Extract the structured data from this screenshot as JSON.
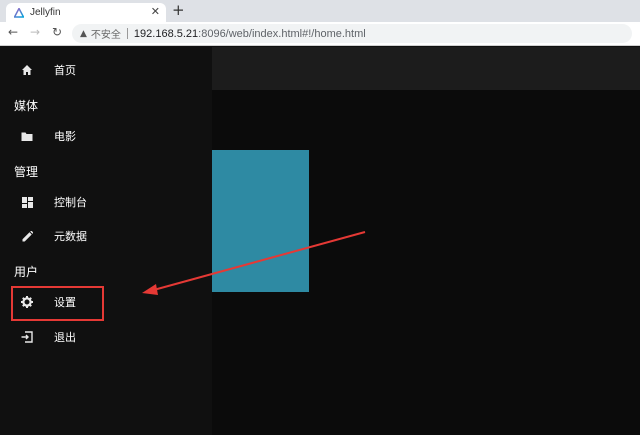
{
  "browser": {
    "tab_title": "Jellyfin",
    "tab_close": "✕",
    "new_tab": "+",
    "back": "←",
    "forward": "→",
    "reload": "↻",
    "insecure_label": "不安全",
    "url_host": "192.168.5.21",
    "url_path": ":8096/web/index.html#!/home.html"
  },
  "sidebar": {
    "home": "首页",
    "media_header": "媒体",
    "movies": "电影",
    "admin_header": "管理",
    "dashboard": "控制台",
    "metadata": "元数据",
    "user_header": "用户",
    "settings": "设置",
    "logout": "退出"
  },
  "colors": {
    "poster": "#2e8aa3",
    "annotation": "#e53935"
  }
}
